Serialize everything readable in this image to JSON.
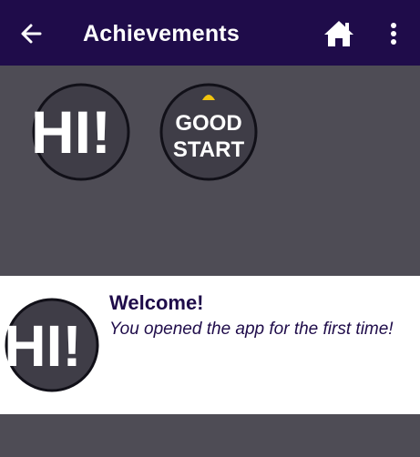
{
  "app_bar": {
    "title": "Achievements",
    "back_icon": "arrow-left-icon",
    "home_icon": "home-icon",
    "menu_icon": "more-vertical-icon",
    "background": "#1f0c4a"
  },
  "badges": [
    {
      "name": "hi-badge",
      "text": "HI!"
    },
    {
      "name": "good-start-badge",
      "line1": "GOOD",
      "line2": "START"
    }
  ],
  "detail": {
    "title": "Welcome!",
    "description": "You opened the app for the first time!",
    "badge_text": "HI!"
  },
  "colors": {
    "background": "#4e4c55",
    "badge_fill": "#3f3d47",
    "accent_blue": "#8fc3ee",
    "accent_yellow": "#f1c40f",
    "text_dark": "#1f0c4a"
  }
}
